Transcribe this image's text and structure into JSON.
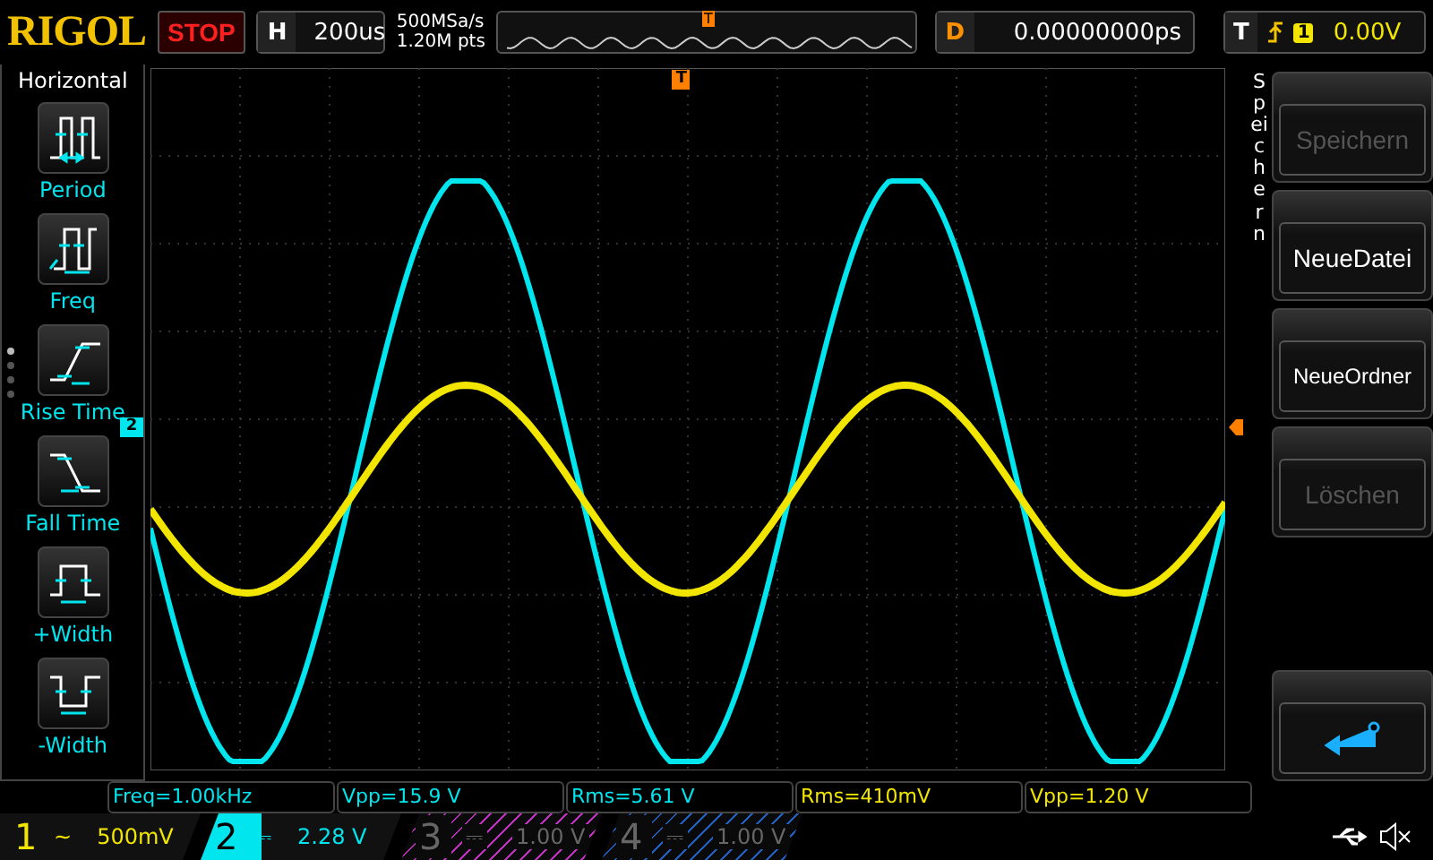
{
  "header": {
    "logo": "RIGOL",
    "run_state": "STOP",
    "timebase": {
      "label": "H",
      "value": "200us"
    },
    "sample_rate": "500MSa/s",
    "memory_depth": "1.20M pts",
    "overview_marker": "T",
    "delay": {
      "label": "D",
      "value": "0.00000000ps"
    },
    "trigger": {
      "label": "T",
      "channel": "1",
      "level": "0.00V"
    }
  },
  "measure_menu": {
    "title": "Horizontal",
    "items": [
      {
        "label": "Period",
        "kind": "period"
      },
      {
        "label": "Freq",
        "kind": "freq"
      },
      {
        "label": "Rise Time",
        "kind": "rise"
      },
      {
        "label": "Fall Time",
        "kind": "fall"
      },
      {
        "label": "+Width",
        "kind": "pwidth"
      },
      {
        "label": "-Width",
        "kind": "nwidth"
      }
    ]
  },
  "plot": {
    "trigger_marker": "T",
    "channel_marker": "2"
  },
  "side_menu": {
    "title": "Speichern",
    "buttons": [
      {
        "label": "Speichern",
        "disabled": true
      },
      {
        "label": "NeueDatei",
        "disabled": false
      },
      {
        "label": "NeueOrdner",
        "disabled": false
      },
      {
        "label": "Löschen",
        "disabled": true
      }
    ]
  },
  "measurements": [
    {
      "text": "Freq=1.00kHz",
      "color": "#00e5ee"
    },
    {
      "text": "Vpp=15.9 V",
      "color": "#00e5ee"
    },
    {
      "text": "Rms=5.61 V",
      "color": "#00e5ee"
    },
    {
      "text": "Rms=410mV",
      "color": "#f2e600"
    },
    {
      "text": "Vpp=1.20 V",
      "color": "#f2e600"
    }
  ],
  "channels": [
    {
      "number": "1",
      "coupling": "~",
      "scale": "500mV",
      "on": true,
      "selected": false,
      "color": "#f2e600"
    },
    {
      "number": "2",
      "coupling": "⎓",
      "scale": "2.28 V",
      "on": true,
      "selected": true,
      "color": "#00e5ee"
    },
    {
      "number": "3",
      "coupling": "⎓",
      "scale": "1.00 V",
      "on": false,
      "selected": false,
      "color": "#c030c0"
    },
    {
      "number": "4",
      "coupling": "⎓",
      "scale": "1.00 V",
      "on": false,
      "selected": false,
      "color": "#2060c0"
    }
  ]
}
